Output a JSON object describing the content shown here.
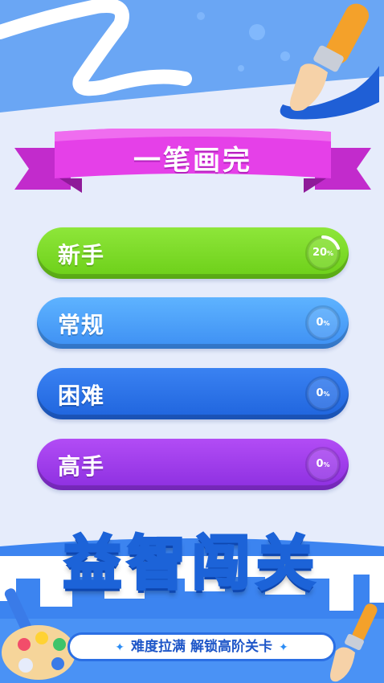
{
  "title": "一笔画完",
  "levels": [
    {
      "label": "新手",
      "progress_value": "20",
      "progress_unit": "%",
      "progress": 0.2
    },
    {
      "label": "常规",
      "progress_value": "0",
      "progress_unit": "%",
      "progress": 0
    },
    {
      "label": "困难",
      "progress_value": "0",
      "progress_unit": "%",
      "progress": 0
    },
    {
      "label": "高手",
      "progress_value": "0",
      "progress_unit": "%",
      "progress": 0
    }
  ],
  "banner": {
    "title": "益智闯关",
    "slogan": "难度拉满 解锁高阶关卡",
    "star_left": "✦",
    "star_right": "✦"
  },
  "colors": {
    "green": "#7bd626",
    "blue": "#4aa0fa",
    "dark_blue": "#2a72e8",
    "purple": "#a03ee9",
    "ribbon": "#e540e8",
    "banner_yellow": "#ffe14a"
  }
}
